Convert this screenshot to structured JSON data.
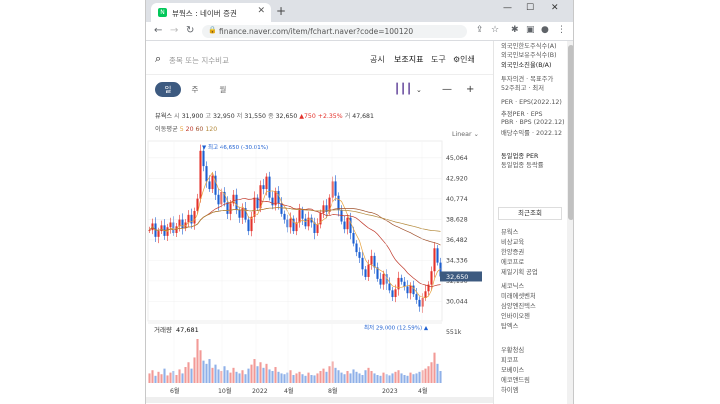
{
  "browser": {
    "tab_title": "뷰웍스 : 네이버 증권",
    "tab_favicon": "N",
    "url": "finance.naver.com/item/fchart.naver?code=100120"
  },
  "search": {
    "placeholder": "종목 또는 지수비교"
  },
  "top_menu": {
    "notice": "공시",
    "indicators": "보조지표",
    "draw": "도구",
    "print": "인쇄"
  },
  "periods": {
    "day": "일",
    "week": "주",
    "month": "월"
  },
  "quote": {
    "name": "뷰웍스",
    "open_label": "시",
    "open": "31,900",
    "high_label": "고",
    "high": "32,950",
    "low_label": "저",
    "low": "31,550",
    "close_label": "종",
    "close": "32,650",
    "change": "▲750",
    "change_pct": "+2.35%",
    "volume_label": "거",
    "volume": "47,681"
  },
  "moving_avg": {
    "label": "이동평균",
    "m5": "5",
    "m20": "20",
    "m60": "60",
    "m120": "120"
  },
  "scale_label": "Linear",
  "colors": {
    "up": "#e4322b",
    "down": "#1d5fd1",
    "ma5": "#e6a23c",
    "ma20": "#c0392b",
    "ma60": "#a0522d",
    "ma120": "#b48a3c",
    "price_tag": "#3d5a80"
  },
  "side_panel": {
    "lines": [
      "외국인한도주식수(A)",
      "외국인보유주식수(B)",
      "외국인소진율(B/A)",
      "투자의견 · 목표주가",
      "52주최고 · 최저",
      "PER · EPS(2022.12)",
      "추정PER · EPS",
      "PBR · BPS (2022.12)",
      "배당수익률 · 2022.12",
      "동일업종 PER",
      "동일업종 등락률"
    ],
    "recent_title": "최근조회",
    "recent_items": [
      "뷰웍스",
      "비상교육",
      "한양증권",
      "에코프로",
      "제일기획 공업",
      "세코닉스",
      "미래에셋벤처",
      "삼양엔진텍스",
      "인바이오젠",
      "탑엑스",
      "우황청심",
      "피코프",
      "모베이스",
      "에코앤드림",
      "하이엠"
    ]
  },
  "chart_data": {
    "type": "candlestick",
    "title": "",
    "price_axis_ticks": [
      45064,
      42920,
      40774,
      38628,
      36482,
      34336,
      32190,
      30044
    ],
    "ylim": [
      28200,
      46200
    ],
    "time_axis_ticks": [
      "6월",
      "10월",
      "2022",
      "4월",
      "8월",
      "2023",
      "4월"
    ],
    "annotations": {
      "high": "최고 46,650 (-30.01%)",
      "low": "최저 29,000 (12.59%)",
      "last_price": "32,650"
    },
    "volume_label": "거래량",
    "volume_value": "47,681",
    "volume_axis_max": "551k",
    "close_series": [
      37500,
      38200,
      36800,
      37400,
      38000,
      36900,
      37800,
      38300,
      37200,
      37900,
      38600,
      37700,
      38300,
      39100,
      38200,
      39500,
      40800,
      45800,
      44200,
      42600,
      41800,
      43200,
      41200,
      40200,
      41500,
      40400,
      39200,
      40300,
      41200,
      39600,
      38800,
      39800,
      38600,
      37400,
      38900,
      40900,
      39800,
      42200,
      41800,
      43100,
      40900,
      40100,
      41600,
      40300,
      39200,
      38600,
      37800,
      38700,
      37400,
      38300,
      39600,
      38700,
      37900,
      38800,
      38300,
      37200,
      38100,
      39300,
      40100,
      39400,
      40900,
      42600,
      41100,
      39600,
      38400,
      37600,
      38800,
      37200,
      36100,
      35200,
      34600,
      33400,
      32600,
      33900,
      34800,
      33600,
      32400,
      31800,
      32900,
      31900,
      31200,
      30500,
      31300,
      32500,
      32100,
      31600,
      30900,
      31700,
      30800,
      30200,
      29500,
      30400,
      31100,
      31800,
      33200,
      35600,
      34100,
      32650
    ],
    "volume_series": [
      120,
      160,
      90,
      140,
      110,
      180,
      95,
      130,
      150,
      100,
      170,
      120,
      200,
      260,
      180,
      320,
      551,
      410,
      280,
      240,
      300,
      190,
      230,
      170,
      150,
      210,
      160,
      130,
      190,
      140,
      120,
      160,
      110,
      180,
      230,
      300,
      210,
      260,
      190,
      240,
      170,
      150,
      200,
      140,
      120,
      110,
      130,
      160,
      100,
      120,
      140,
      110,
      90,
      130,
      100,
      95,
      120,
      150,
      180,
      140,
      210,
      270,
      190,
      160,
      130,
      110,
      150,
      120,
      170,
      140,
      120,
      100,
      160,
      190,
      150,
      120,
      100,
      90,
      130,
      110,
      95,
      120,
      140,
      160,
      120,
      100,
      90,
      130,
      110,
      120,
      140,
      160,
      180,
      210,
      260,
      380,
      240,
      150
    ]
  }
}
